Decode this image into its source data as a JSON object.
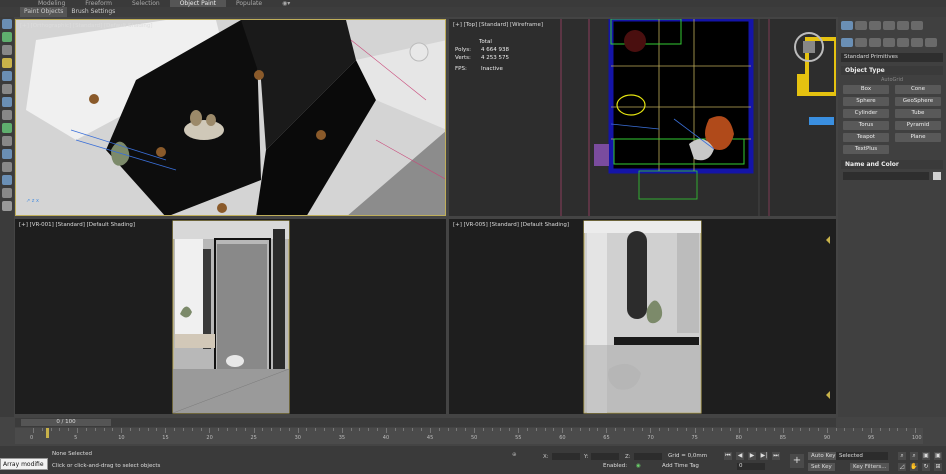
{
  "ribbon": {
    "tabs": [
      "Modeling",
      "Freeform",
      "Selection",
      "Object Paint",
      "Populate"
    ],
    "sub_tabs": [
      "Paint Objects",
      "Brush Settings"
    ]
  },
  "viewports": {
    "top_left": {
      "label": "[+] [Orthographic] [Standard] [Default Shading]"
    },
    "top_right": {
      "label": "[+] [Top] [Standard] [Wireframe]"
    },
    "bottom_left": {
      "label": "[+] [VR-001] [Standard] [Default Shading]"
    },
    "bottom_right": {
      "label": "[+] [VR-005] [Standard] [Default Shading]"
    }
  },
  "stats": {
    "total_label": "Total",
    "polys_label": "Polys:",
    "polys_value": "4 664 938",
    "verts_label": "Verts:",
    "verts_value": "4 253 575",
    "fps_label": "FPS:",
    "fps_value": "Inactive"
  },
  "command_panel": {
    "category": "Standard Primitives",
    "object_type_title": "Object Type",
    "autogrid": "AutoGrid",
    "buttons": [
      "Box",
      "Cone",
      "Sphere",
      "GeoSphere",
      "Cylinder",
      "Tube",
      "Torus",
      "Pyramid",
      "Teapot",
      "Plane",
      "TextPlus"
    ],
    "name_color_title": "Name and Color"
  },
  "timeline": {
    "frame_display": "0 / 100",
    "ticks": [
      "0",
      "5",
      "10",
      "15",
      "20",
      "25",
      "30",
      "35",
      "40",
      "45",
      "50",
      "55",
      "60",
      "65",
      "70",
      "75",
      "80",
      "85",
      "90",
      "95",
      "100"
    ]
  },
  "status": {
    "script_text": "Array modifie",
    "selection": "None Selected",
    "prompt": "Click or click-and-drag to select objects",
    "x_label": "X:",
    "y_label": "Y:",
    "z_label": "Z:",
    "grid": "Grid = 0,0mm",
    "enabled": "Enabled:",
    "add_time_tag": "Add Time Tag",
    "auto_key": "Auto Key",
    "set_key": "Set Key",
    "key_mode": "Selected",
    "key_filters": "Key Filters...",
    "current_frame": "0"
  },
  "colors": {
    "accent_yellow": "#bfae5a",
    "wire_blue": "#1414a8",
    "panel_bg": "#404040"
  }
}
